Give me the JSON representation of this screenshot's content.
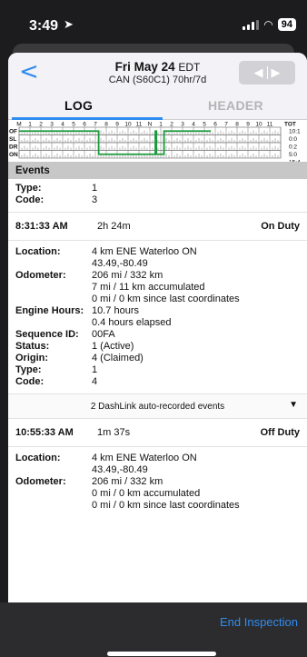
{
  "status_bar": {
    "time": "3:49",
    "battery": "94"
  },
  "nav": {
    "back_label": "<",
    "date": "Fri May 24",
    "timezone": "EDT",
    "subtitle": "CAN (S60C1) 70hr/7d",
    "pager_prev": "◀",
    "pager_next": "▶"
  },
  "tabs": {
    "log": "LOG",
    "header": "HEADER"
  },
  "graph": {
    "hour_labels": [
      "M",
      "1",
      "2",
      "3",
      "4",
      "5",
      "6",
      "7",
      "8",
      "9",
      "10",
      "11",
      "N",
      "1",
      "2",
      "3",
      "4",
      "5",
      "6",
      "7",
      "8",
      "9",
      "10",
      "11"
    ],
    "row_labels": [
      "OF",
      "SL",
      "DR",
      "ON"
    ],
    "total_label": "TOT",
    "totals": [
      "10:1",
      "0:0",
      "0:2",
      "5:0"
    ],
    "grand_total": "15:4",
    "line_color": "#1a9a3a"
  },
  "events_title": "Events",
  "prev_event_tail": {
    "type_label": "Type:",
    "type_value": "1",
    "code_label": "Code:",
    "code_value": "3"
  },
  "event1": {
    "time": "8:31:33 AM",
    "duration": "2h 24m",
    "status": "On Duty",
    "location_label": "Location:",
    "location": "4 km ENE Waterloo ON",
    "coords": "43.49,-80.49",
    "odometer_label": "Odometer:",
    "odometer": "206 mi / 332 km",
    "odo_accum": "7 mi / 11 km accumulated",
    "odo_since": "0 mi / 0 km since last coordinates",
    "engine_label": "Engine Hours:",
    "engine_hours": "10.7 hours",
    "engine_elapsed": "0.4 hours elapsed",
    "seq_label": "Sequence ID:",
    "seq": "00FA",
    "status_label": "Status:",
    "status_value": "1 (Active)",
    "origin_label": "Origin:",
    "origin": "4 (Claimed)",
    "type_label": "Type:",
    "type": "1",
    "code_label": "Code:",
    "code": "4"
  },
  "dashlink": {
    "text": "2 DashLink auto-recorded events",
    "caret": "▼"
  },
  "event2": {
    "time": "10:55:33 AM",
    "duration": "1m 37s",
    "status": "Off Duty",
    "location_label": "Location:",
    "location": "4 km ENE Waterloo ON",
    "coords": "43.49,-80.49",
    "odometer_label": "Odometer:",
    "odometer": "206 mi / 332 km",
    "odo_accum": "0 mi / 0 km accumulated",
    "odo_since": "0 mi / 0 km since last coordinates"
  },
  "bottom": {
    "end_inspection": "End Inspection"
  }
}
